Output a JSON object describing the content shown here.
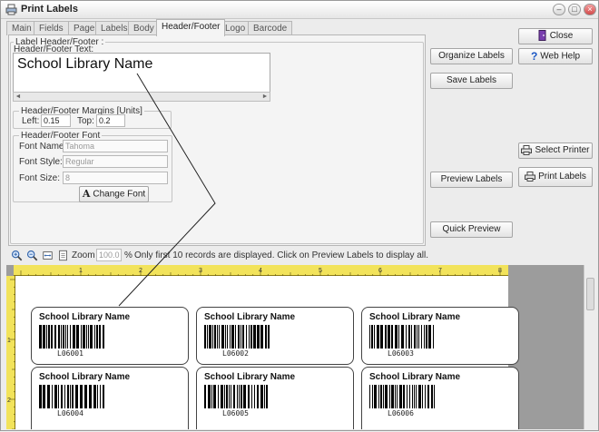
{
  "window": {
    "title": "Print Labels"
  },
  "tabs": [
    "Main",
    "Fields",
    "Page",
    "Labels",
    "Body",
    "Header/Footer",
    "Logo",
    "Barcode"
  ],
  "active_tab": "Header/Footer",
  "header_footer": {
    "group_title": "Label Header/Footer :",
    "text_label": "Header/Footer Text:",
    "text_value": "School Library Name",
    "margins": {
      "group_title": "Header/Footer Margins [Units]",
      "left_label": "Left:",
      "left_value": "0.15",
      "top_label": "Top:",
      "top_value": "0.2"
    },
    "font": {
      "group_title": "Header/Footer Font",
      "name_label": "Font Name:",
      "name_value": "Tahoma",
      "style_label": "Font Style:",
      "style_value": "Regular",
      "size_label": "Font Size:",
      "size_value": "8",
      "change_button": "Change Font"
    }
  },
  "actions": {
    "organize": "Organize Labels",
    "save": "Save Labels",
    "preview": "Preview Labels",
    "quick_preview": "Quick Preview",
    "close": "Close",
    "web_help": "Web Help",
    "select_printer": "Select Printer",
    "print_labels": "Print Labels"
  },
  "toolbar": {
    "zoom_label": "Zoom",
    "zoom_value": "100.0",
    "percent": "%",
    "notice": "Only first 10 records are displayed. Click on Preview Labels to display all."
  },
  "ruler": {
    "top_marks": [
      "1",
      "2",
      "3",
      "4",
      "5",
      "6",
      "7",
      "8"
    ],
    "left_marks": [
      "1",
      "2"
    ]
  },
  "labels": [
    {
      "title": "School Library Name",
      "code": "L06001"
    },
    {
      "title": "School Library Name",
      "code": "L06002"
    },
    {
      "title": "School Library Name",
      "code": "L06003"
    },
    {
      "title": "School Library Name",
      "code": "L06004"
    },
    {
      "title": "School Library Name",
      "code": "L06005"
    },
    {
      "title": "School Library Name",
      "code": "L06006"
    }
  ],
  "colors": {
    "ruler": "#f2e35b",
    "preview_bg": "#9c9c9c"
  }
}
